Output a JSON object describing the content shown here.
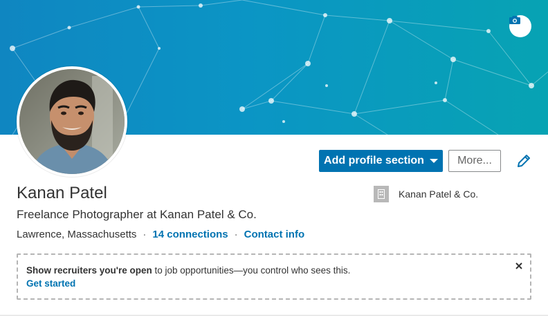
{
  "profile": {
    "name": "Kanan Patel",
    "headline": "Freelance Photographer at Kanan Patel & Co.",
    "location": "Lawrence, Massachusetts",
    "separator": "·",
    "connections_label": "14 connections",
    "contact_label": "Contact info"
  },
  "actions": {
    "add_section_label": "Add profile section",
    "more_label": "More..."
  },
  "company": {
    "name": "Kanan Patel & Co."
  },
  "notice": {
    "bold_text": "Show recruiters you're open",
    "rest_text": " to job opportunities—you control who sees this.",
    "cta_label": "Get started"
  },
  "icons": {
    "camera": "camera-icon",
    "edit": "pencil-icon",
    "close": "close-icon",
    "company": "building-icon",
    "caret": "caret-down-icon"
  },
  "colors": {
    "primary": "#0073b1",
    "banner_start": "#0f86c1",
    "banner_end": "#07a3b3"
  }
}
